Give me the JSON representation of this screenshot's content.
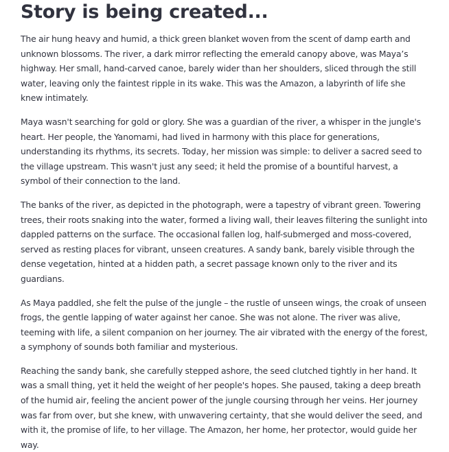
{
  "title": "Story is being created...",
  "paragraphs": [
    "The air hung heavy and humid, a thick green blanket woven from the scent of damp earth and unknown blossoms. The river, a dark mirror reflecting the emerald canopy above, was Maya’s highway. Her small, hand-carved canoe, barely wider than her shoulders, sliced through the still water, leaving only the faintest ripple in its wake. This was the Amazon, a labyrinth of life she knew intimately.",
    "Maya wasn't searching for gold or glory. She was a guardian of the river, a whisper in the jungle's heart. Her people, the Yanomami, had lived in harmony with this place for generations, understanding its rhythms, its secrets. Today, her mission was simple: to deliver a sacred seed to the village upstream. This wasn't just any seed; it held the promise of a bountiful harvest, a symbol of their connection to the land.",
    "The banks of the river, as depicted in the photograph, were a tapestry of vibrant green. Towering trees, their roots snaking into the water, formed a living wall, their leaves filtering the sunlight into dappled patterns on the surface. The occasional fallen log, half-submerged and moss-covered, served as resting places for vibrant, unseen creatures. A sandy bank, barely visible through the dense vegetation, hinted at a hidden path, a secret passage known only to the river and its guardians.",
    "As Maya paddled, she felt the pulse of the jungle – the rustle of unseen wings, the croak of unseen frogs, the gentle lapping of water against her canoe. She was not alone. The river was alive, teeming with life, a silent companion on her journey. The air vibrated with the energy of the forest, a symphony of sounds both familiar and mysterious.",
    "Reaching the sandy bank, she carefully stepped ashore, the seed clutched tightly in her hand. It was a small thing, yet it held the weight of her people's hopes. She paused, taking a deep breath of the humid air, feeling the ancient power of the jungle coursing through her veins. Her journey was far from over, but she knew, with unwavering certainty, that she would deliver the seed, and with it, the promise of life, to her village. The Amazon, her home, her protector, would guide her way."
  ],
  "colors": {
    "text": "#31333f",
    "background": "#ffffff"
  }
}
